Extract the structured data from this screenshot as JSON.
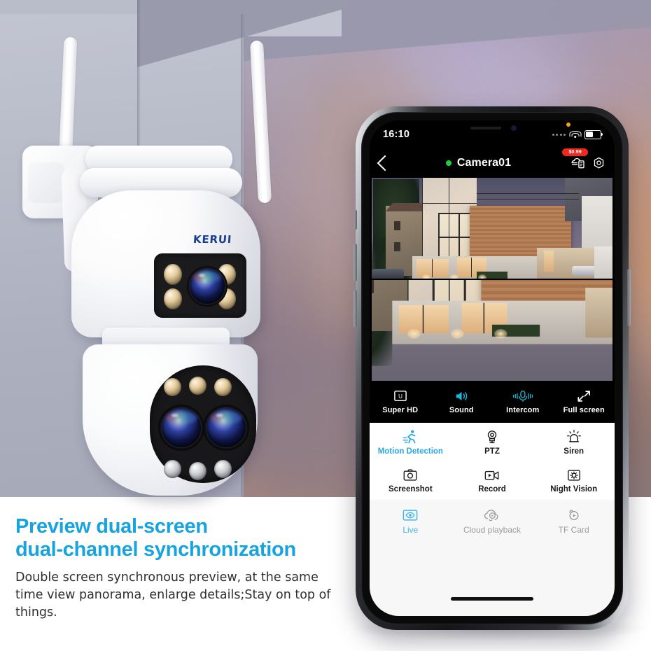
{
  "marketing": {
    "headline_line1": "Preview dual-screen",
    "headline_line2": "dual-channel synchronization",
    "body": "Double screen synchronous preview, at the same time view panorama, enlarge details;Stay on top of things.",
    "accent_color": "#17a3e0"
  },
  "product": {
    "brand": "KERUI"
  },
  "phone": {
    "status_bar": {
      "time": "16:10",
      "signal_icon": "signal-dots-icon",
      "wifi_icon": "wifi-icon",
      "battery_icon": "battery-icon",
      "recording_indicator": "orange-privacy-dot"
    },
    "app_bar": {
      "back_icon": "back-chevron-icon",
      "status_dot_color": "#19d33c",
      "camera_name": "Camera01",
      "cloud_icon": "cloud-purchase-icon",
      "price_badge": "$0.99",
      "settings_icon": "gear-icon"
    },
    "controls": [
      {
        "label": "Super HD",
        "icon": "super-hd-icon",
        "active": false
      },
      {
        "label": "Sound",
        "icon": "speaker-icon",
        "active": true
      },
      {
        "label": "Intercom",
        "icon": "microphone-icon",
        "active": true
      },
      {
        "label": "Full screen",
        "icon": "expand-icon",
        "active": false
      }
    ],
    "features": [
      {
        "label": "Motion Detection",
        "icon": "running-person-icon",
        "active": true
      },
      {
        "label": "PTZ",
        "icon": "ptz-camera-icon",
        "active": false
      },
      {
        "label": "Siren",
        "icon": "siren-icon",
        "active": false
      },
      {
        "label": "Screenshot",
        "icon": "camera-icon",
        "active": false
      },
      {
        "label": "Record",
        "icon": "video-record-icon",
        "active": false
      },
      {
        "label": "Night Vision",
        "icon": "night-vision-icon",
        "active": false
      }
    ],
    "tabs": [
      {
        "label": "Live",
        "icon": "eye-live-icon",
        "active": true
      },
      {
        "label": "Cloud playback",
        "icon": "cloud-play-icon",
        "active": false
      },
      {
        "label": "TF Card",
        "icon": "tf-card-play-icon",
        "active": false
      }
    ],
    "video": {
      "channels": 2,
      "description": "Dual-channel live view of a modern two-storey house at dusk"
    }
  }
}
